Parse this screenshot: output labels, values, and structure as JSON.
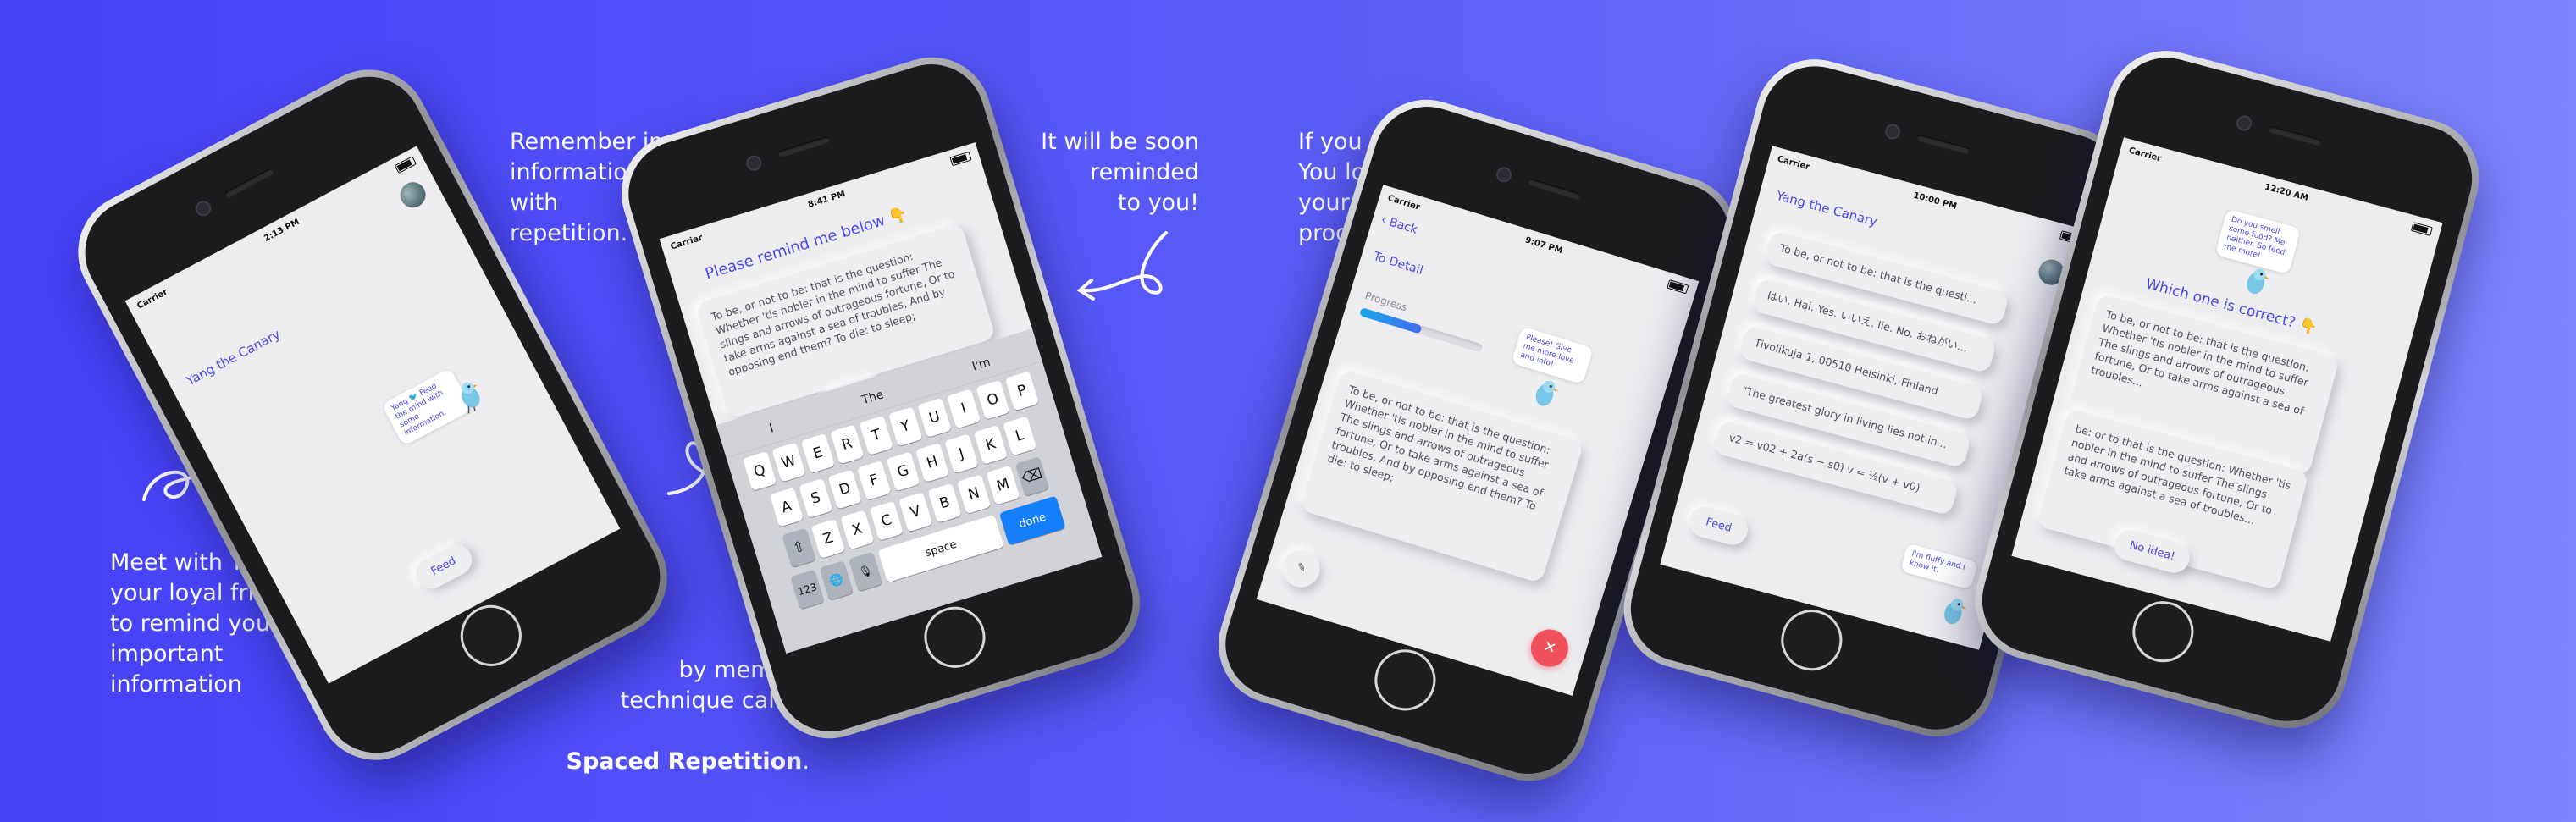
{
  "captions": {
    "meet": "Meet with Yang\nyour loyal friend\nto remind you\nimportant\ninformation",
    "remember": "Remember important\ninformation\nwith\nrepetition.",
    "memory_line1": "by memory\ntechnique called",
    "memory_bold": "Spaced Repetition",
    "memory_tail": ".",
    "soon": "It will be soon\nreminded\nto you!",
    "edit": "If you edit!\nYou lose\nyour\nprogress"
  },
  "phone1": {
    "carrier": "Carrier",
    "time": "2:13 PM",
    "title": "Yang the Canary",
    "bubble": "Yang 🐦 Feed the mind with some information.",
    "feed_button": "Feed"
  },
  "phone2": {
    "carrier": "Carrier",
    "time": "8:41 PM",
    "heading": "Please remind me below 👇",
    "text": "To be, or not to be: that is the question: Whether 'tis nobler in the mind to suffer The slings and arrows of outrageous fortune, Or to take arms against a sea of troubles, And by opposing end them? To die: to sleep;",
    "done_button": "Done",
    "keyboard": {
      "suggestions": [
        "I",
        "The",
        "I'm"
      ],
      "row1": [
        "Q",
        "W",
        "E",
        "R",
        "T",
        "Y",
        "U",
        "I",
        "O",
        "P"
      ],
      "row2": [
        "A",
        "S",
        "D",
        "F",
        "G",
        "H",
        "J",
        "K",
        "L"
      ],
      "row3": [
        "Z",
        "X",
        "C",
        "V",
        "B",
        "N",
        "M"
      ],
      "shift": "⇧",
      "backspace": "⌫",
      "numbers": "123",
      "globe": "🌐",
      "mic": "🎙",
      "space": "space",
      "done": "done"
    }
  },
  "phone3": {
    "carrier": "Carrier",
    "time": "9:07 PM",
    "back": "Back",
    "title": "To Detail",
    "progress_label": "Progress",
    "progress_value": 0.5,
    "bubble": "Please! Give me more love and info!",
    "text": "To be, or not to be: that is the question: Whether 'tis nobler in the mind to suffer The slings and arrows of outrageous fortune, Or to take arms against a sea of troubles, And by opposing end them? To die: to sleep;",
    "share_icon": "✎",
    "delete_icon": "✕"
  },
  "phone4": {
    "carrier": "Carrier",
    "time": "10:00 PM",
    "title": "Yang the Canary",
    "items": [
      "To be, or not to be: that is the questi...",
      "はい. Hai. Yes. いいえ. Iie. No. おねがい...",
      "Tivolikuja 1, 00510 Helsinki, Finland",
      "\"The greatest glory in living lies not in...",
      "v2 = v02 + 2a(s − s0)   v = ½(v + v0)"
    ],
    "feed_button": "Feed",
    "bubble": "I'm fluffy and I know it."
  },
  "phone5": {
    "carrier": "Carrier",
    "time": "12:20 AM",
    "bubble": "Do you smell some food? Me neither. So feed me more!",
    "question": "Which one is correct? 👇",
    "option1": "To be, or not to be: that is the question: Whether 'tis nobler in the mind to suffer The slings and arrows of outrageous fortune, Or to take arms against a sea of troubles...",
    "option2": "be: or to that is the question: Whether 'tis nobler in the mind to suffer The slings and arrows of outrageous fortune, Or to take arms against a sea of troubles...",
    "no_idea_button": "No idea!"
  },
  "colors": {
    "accent": "#4b48e8",
    "background_start": "#4541f7",
    "background_end": "#7c83fb",
    "keyboard_done": "#157efb",
    "delete_red": "#f0505b"
  }
}
